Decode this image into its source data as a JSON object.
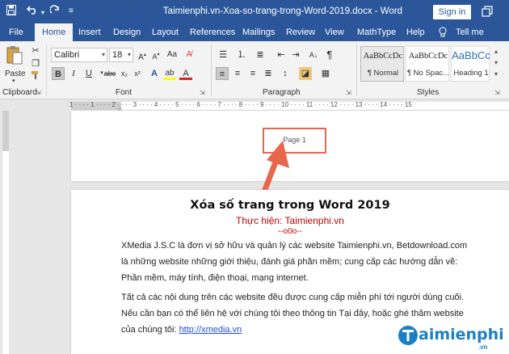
{
  "window": {
    "title": "Taimienphi.vn-Xoa-so-trang-trong-Word-2019.docx - Word",
    "sign_in": "Sign in",
    "restore_icon": "restore-icon"
  },
  "quick_access": [
    {
      "name": "save-icon"
    },
    {
      "name": "undo-icon"
    },
    {
      "name": "redo-icon"
    },
    {
      "name": "customize-icon"
    }
  ],
  "tabs": [
    "File",
    "Home",
    "Insert",
    "Design",
    "Layout",
    "References",
    "Mailings",
    "Review",
    "View",
    "MathType",
    "Help",
    "Tell me"
  ],
  "ribbon": {
    "clipboard": {
      "paste": "Paste",
      "label": "Clipboard"
    },
    "font": {
      "name": "Calibri",
      "size": "18",
      "label": "Font",
      "bold": "B",
      "italic": "I",
      "underline": "U"
    },
    "paragraph": {
      "label": "Paragraph"
    },
    "styles": {
      "label": "Styles",
      "items": [
        {
          "sample": "AaBbCcDc",
          "name": "¶ Normal"
        },
        {
          "sample": "AaBbCcDc",
          "name": "¶ No Spac..."
        },
        {
          "sample": "AaBbCc",
          "name": "Heading 1"
        }
      ]
    }
  },
  "document": {
    "page1_header": "Page 1",
    "title": "Xóa số trang trong Word 2019",
    "subtitle": "Thực hiện: Taimienphi.vn",
    "decoration": "--o0o--",
    "para1": "XMedia J.S.C là đơn vị sở hữu và quản lý các website Taimienphi.vn, Betdownload.com là những website những giới thiệu, đánh giá phần mềm; cung cấp các hướng dẫn về: Phần mềm, máy tính, điện thoại, mạng internet.",
    "para2": "Tất cả các nội dung trên các website đều được cung cấp miễn phí tới người dùng cuối. Nếu cần bạn có thể liên hệ với chúng tôi theo thông tin Tại đây, hoặc ghé thăm website của chúng tôi:",
    "link": "http://xmedia.vn"
  },
  "ruler_marks": "1 · · · · 1 · · · · 2 · · · · 3 · · · · 4 · · · · 5 · · · · 6 · · · · 7 · · · · 8 · · · · 9 · · · · 10 · · · · 11 · · · · 12 · · · · 13 · · · · 14 · · · · 15",
  "watermark": {
    "text": "aimienphi",
    "sub": ".vn"
  },
  "colors": {
    "brand": "#2b579a",
    "highlight": "#e8664b",
    "subtitle": "#c00000",
    "link": "#1f4fd6"
  }
}
